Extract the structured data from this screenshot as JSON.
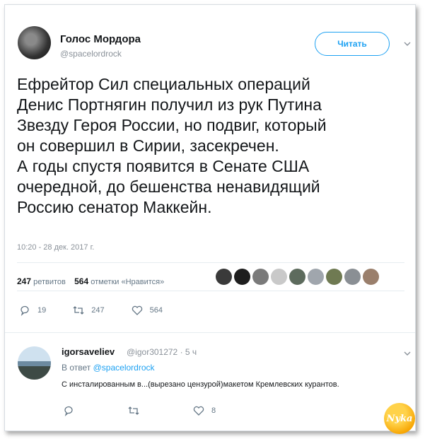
{
  "tweet": {
    "author_name": "Голос Мордора",
    "author_handle": "@spacelordrock",
    "follow_label": "Читать",
    "body_lines": [
      "Ефрейтор Сил специальных операций",
      "Денис Портнягин получил из рук Путина",
      "Звезду Героя России, но подвиг, который",
      "он совершил в Сирии, засекречен.",
      "А годы спустя появится в Сенате США",
      "очередной, до бешенства ненавидящий",
      "Россию сенатор Маккейн."
    ],
    "timestamp": "10:20 - 28 дек. 2017 г.",
    "retweets_count": "247",
    "retweets_label": "ретвитов",
    "likes_count": "564",
    "likes_label": "отметки «Нравится»",
    "actions": {
      "replies": "19",
      "retweets": "247",
      "likes": "564"
    }
  },
  "reply": {
    "author_name": "igorsaveliev",
    "author_handle": "@igor301272",
    "time": "· 5 ч",
    "in_reply_prefix": "В ответ",
    "in_reply_handle": "@spacelordrock",
    "text": "С инсталированным в...(вырезано цензурой)макетом Кремлевских курантов.",
    "actions": {
      "replies": "",
      "retweets": "",
      "likes": "8"
    }
  },
  "watermark": "Nyka",
  "colors": {
    "accent": "#1da1f2",
    "muted": "#657786",
    "text": "#14171a"
  },
  "icons": {
    "reply": "reply-icon",
    "retweet": "retweet-icon",
    "like": "heart-icon",
    "menu": "chevron-down-icon"
  }
}
